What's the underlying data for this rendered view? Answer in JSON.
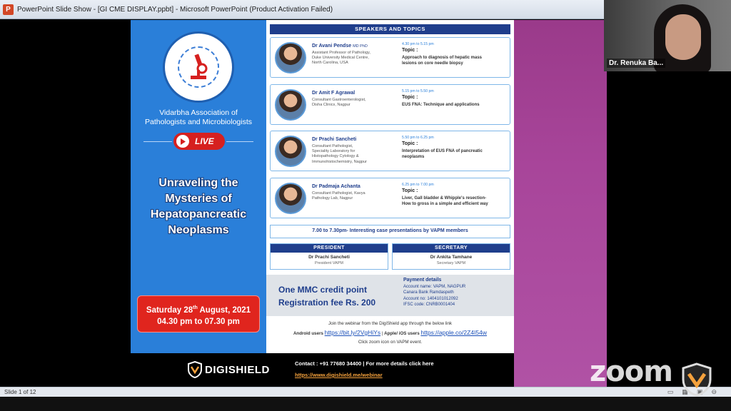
{
  "window": {
    "title": "PowerPoint Slide Show - [GI CME DISPLAY.ppbt] - Microsoft PowerPoint (Product Activation Failed)",
    "app_icon_letter": "P"
  },
  "status_bar": {
    "slide_counter": "Slide 1 of 12"
  },
  "slide": {
    "org_name_line1": "Vidarbha Association of",
    "org_name_line2": "Pathologists and Microbiologists",
    "live_label": "LIVE",
    "title_lines": [
      "Unraveling the",
      "Mysteries of",
      "Hepatopancreatic",
      "Neoplasms"
    ],
    "date_line1_pre": "Saturday 28",
    "date_line1_sup": "th",
    "date_line1_post": " August, 2021",
    "date_line2": "04.30 pm to 07.30 pm",
    "speakers_header": "SPEAKERS AND TOPICS",
    "topic_label": "Topic :",
    "speakers": [
      {
        "name": "Dr Avani Pendse",
        "credential": "MD PhD",
        "desc_lines": [
          "Assistant Professor of Pathology,",
          "Duke University Medical Centre,",
          "North Carolina, USA"
        ],
        "time": "4.30 pm to 5.15 pm",
        "topic_lines": [
          "Approach to diagnosis of hepatic mass",
          "lesions on core needle biopsy"
        ]
      },
      {
        "name": "Dr Amit F Agrawal",
        "credential": "",
        "desc_lines": [
          "Consultant Gastroenterologist,",
          "Disha Clinics, Nagpur"
        ],
        "time": "5.15 pm to 5.50 pm",
        "topic_lines": [
          "EUS FNA: Technique and applications"
        ]
      },
      {
        "name": "Dr Prachi Sancheti",
        "credential": "",
        "desc_lines": [
          "Consultant Pathologist,",
          "Speciality Laboratory for",
          "Histopathology Cytology &",
          "Immunohistochemistry, Nagpur"
        ],
        "time": "5.50 pm to 6.25 pm",
        "topic_lines": [
          "Interpretation of EUS FNA of pancreatic",
          "neoplasms"
        ]
      },
      {
        "name": "Dr Padmaja Achanta",
        "credential": "",
        "desc_lines": [
          "Consultant Pathologist, Kavya",
          "Pathology Lab, Nagpur"
        ],
        "time": "6.25 pm to 7.00 pm",
        "topic_lines": [
          "Liver, Gall bladder & Whipple's resection-",
          "How to gross in a simple and efficient way"
        ]
      }
    ],
    "case_presentations": "7.00 to 7.30pm- Interesting case presentations by VAPM members",
    "president": {
      "header": "PRESIDENT",
      "name": "Dr Prachi Sancheti",
      "role": "President VAPM"
    },
    "secretary": {
      "header": "SECRETARY",
      "name": "Dr Ankita Tamhane",
      "role": "Secretary VAPM"
    },
    "credit_line1": "One MMC credit point",
    "credit_line2": "Registration fee Rs. 200",
    "payment": {
      "title": "Payment details",
      "account_name": "Account name: VAPM, NAGPUR",
      "bank": "Canara Bank Ramdaspeth",
      "account_no": "Account no: 1404101012092",
      "ifsc": "IFSC code: CNRB0001404"
    },
    "join_line": "Join the webinar from the DigiShield app through the below link",
    "android_label": "Android users",
    "android_link": "https://bit.ly/2VgHiYs",
    "ios_label": "Apple/ iOS users",
    "ios_link": "https://apple.co/2Z4I54w",
    "zoom_note": "Click zoom icon on VAPM event.",
    "footer_brand": "DIGISHIELD",
    "contact_line": "Contact : +91 77680 34400 | For more details click here",
    "contact_url": "https://www.digishield.me/webinar"
  },
  "webcam": {
    "participant_name": "Dr. Renuka Ba..."
  },
  "watermark": {
    "zoom": "zoom"
  },
  "colors": {
    "slide_blue": "#2a7fd9",
    "header_navy": "#1f3e8c",
    "live_red": "#d6201f",
    "pink_panel": "#a8459a",
    "link_orange": "#f4a13c"
  }
}
